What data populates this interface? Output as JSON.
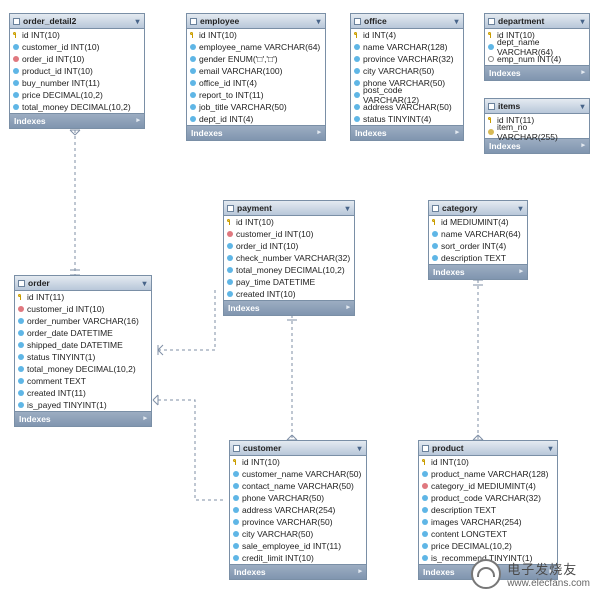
{
  "footer_label": "Indexes",
  "tables": {
    "order_detail2": {
      "name": "order_detail2",
      "cols": [
        {
          "k": "id",
          "t": "INT(10)",
          "i": "key"
        },
        {
          "k": "customer_id",
          "t": "INT(10)",
          "i": "blue"
        },
        {
          "k": "order_id",
          "t": "INT(10)",
          "i": "red"
        },
        {
          "k": "product_id",
          "t": "INT(10)",
          "i": "blue"
        },
        {
          "k": "buy_number",
          "t": "INT(11)",
          "i": "blue"
        },
        {
          "k": "price",
          "t": "DECIMAL(10,2)",
          "i": "blue"
        },
        {
          "k": "total_money",
          "t": "DECIMAL(10,2)",
          "i": "blue"
        }
      ]
    },
    "employee": {
      "name": "employee",
      "cols": [
        {
          "k": "id",
          "t": "INT(10)",
          "i": "key"
        },
        {
          "k": "employee_name",
          "t": "VARCHAR(64)",
          "i": "blue"
        },
        {
          "k": "gender",
          "t": "ENUM('□','□')",
          "i": "blue"
        },
        {
          "k": "email",
          "t": "VARCHAR(100)",
          "i": "blue"
        },
        {
          "k": "office_id",
          "t": "INT(4)",
          "i": "blue"
        },
        {
          "k": "report_to",
          "t": "INT(11)",
          "i": "blue"
        },
        {
          "k": "job_title",
          "t": "VARCHAR(50)",
          "i": "blue"
        },
        {
          "k": "dept_id",
          "t": "INT(4)",
          "i": "blue"
        }
      ]
    },
    "office": {
      "name": "office",
      "cols": [
        {
          "k": "id",
          "t": "INT(4)",
          "i": "key"
        },
        {
          "k": "name",
          "t": "VARCHAR(128)",
          "i": "blue"
        },
        {
          "k": "province",
          "t": "VARCHAR(32)",
          "i": "blue"
        },
        {
          "k": "city",
          "t": "VARCHAR(50)",
          "i": "blue"
        },
        {
          "k": "phone",
          "t": "VARCHAR(50)",
          "i": "blue"
        },
        {
          "k": "post_code",
          "t": "VARCHAR(12)",
          "i": "blue"
        },
        {
          "k": "address",
          "t": "VARCHAR(50)",
          "i": "blue"
        },
        {
          "k": "status",
          "t": "TINYINT(4)",
          "i": "blue"
        }
      ]
    },
    "department": {
      "name": "department",
      "cols": [
        {
          "k": "id",
          "t": "INT(10)",
          "i": "key"
        },
        {
          "k": "dept_name",
          "t": "VARCHAR(64)",
          "i": "blue"
        },
        {
          "k": "emp_num",
          "t": "INT(4)",
          "i": "white"
        }
      ]
    },
    "items": {
      "name": "items",
      "cols": [
        {
          "k": "id",
          "t": "INT(11)",
          "i": "key"
        },
        {
          "k": "item_no",
          "t": "VARCHAR(255)",
          "i": "gold"
        }
      ]
    },
    "payment": {
      "name": "payment",
      "cols": [
        {
          "k": "id",
          "t": "INT(10)",
          "i": "key"
        },
        {
          "k": "customer_id",
          "t": "INT(10)",
          "i": "red"
        },
        {
          "k": "order_id",
          "t": "INT(10)",
          "i": "blue"
        },
        {
          "k": "check_number",
          "t": "VARCHAR(32)",
          "i": "blue"
        },
        {
          "k": "total_money",
          "t": "DECIMAL(10,2)",
          "i": "blue"
        },
        {
          "k": "pay_time",
          "t": "DATETIME",
          "i": "blue"
        },
        {
          "k": "created",
          "t": "INT(10)",
          "i": "blue"
        }
      ]
    },
    "category": {
      "name": "category",
      "cols": [
        {
          "k": "id",
          "t": "MEDIUMINT(4)",
          "i": "key"
        },
        {
          "k": "name",
          "t": "VARCHAR(64)",
          "i": "blue"
        },
        {
          "k": "sort_order",
          "t": "INT(4)",
          "i": "blue"
        },
        {
          "k": "description",
          "t": "TEXT",
          "i": "blue"
        }
      ]
    },
    "order": {
      "name": "order",
      "cols": [
        {
          "k": "id",
          "t": "INT(11)",
          "i": "key"
        },
        {
          "k": "customer_id",
          "t": "INT(10)",
          "i": "red"
        },
        {
          "k": "order_number",
          "t": "VARCHAR(16)",
          "i": "blue"
        },
        {
          "k": "order_date",
          "t": "DATETIME",
          "i": "blue"
        },
        {
          "k": "shipped_date",
          "t": "DATETIME",
          "i": "blue"
        },
        {
          "k": "status",
          "t": "TINYINT(1)",
          "i": "blue"
        },
        {
          "k": "total_money",
          "t": "DECIMAL(10,2)",
          "i": "blue"
        },
        {
          "k": "comment",
          "t": "TEXT",
          "i": "blue"
        },
        {
          "k": "created",
          "t": "INT(11)",
          "i": "blue"
        },
        {
          "k": "is_payed",
          "t": "TINYINT(1)",
          "i": "blue"
        }
      ]
    },
    "customer": {
      "name": "customer",
      "cols": [
        {
          "k": "id",
          "t": "INT(10)",
          "i": "key"
        },
        {
          "k": "customer_name",
          "t": "VARCHAR(50)",
          "i": "blue"
        },
        {
          "k": "contact_name",
          "t": "VARCHAR(50)",
          "i": "blue"
        },
        {
          "k": "phone",
          "t": "VARCHAR(50)",
          "i": "blue"
        },
        {
          "k": "address",
          "t": "VARCHAR(254)",
          "i": "blue"
        },
        {
          "k": "province",
          "t": "VARCHAR(50)",
          "i": "blue"
        },
        {
          "k": "city",
          "t": "VARCHAR(50)",
          "i": "blue"
        },
        {
          "k": "sale_employee_id",
          "t": "INT(11)",
          "i": "blue"
        },
        {
          "k": "credit_limit",
          "t": "INT(10)",
          "i": "blue"
        }
      ]
    },
    "product": {
      "name": "product",
      "cols": [
        {
          "k": "id",
          "t": "INT(10)",
          "i": "key"
        },
        {
          "k": "product_name",
          "t": "VARCHAR(128)",
          "i": "blue"
        },
        {
          "k": "category_id",
          "t": "MEDIUMINT(4)",
          "i": "red"
        },
        {
          "k": "product_code",
          "t": "VARCHAR(32)",
          "i": "blue"
        },
        {
          "k": "description",
          "t": "TEXT",
          "i": "blue"
        },
        {
          "k": "images",
          "t": "VARCHAR(254)",
          "i": "blue"
        },
        {
          "k": "content",
          "t": "LONGTEXT",
          "i": "blue"
        },
        {
          "k": "price",
          "t": "DECIMAL(10,2)",
          "i": "blue"
        },
        {
          "k": "is_recommend",
          "t": "TINYINT(1)",
          "i": "blue"
        }
      ]
    }
  },
  "watermark": {
    "cn": "电子发烧友",
    "url": "www.elecfans.com"
  }
}
